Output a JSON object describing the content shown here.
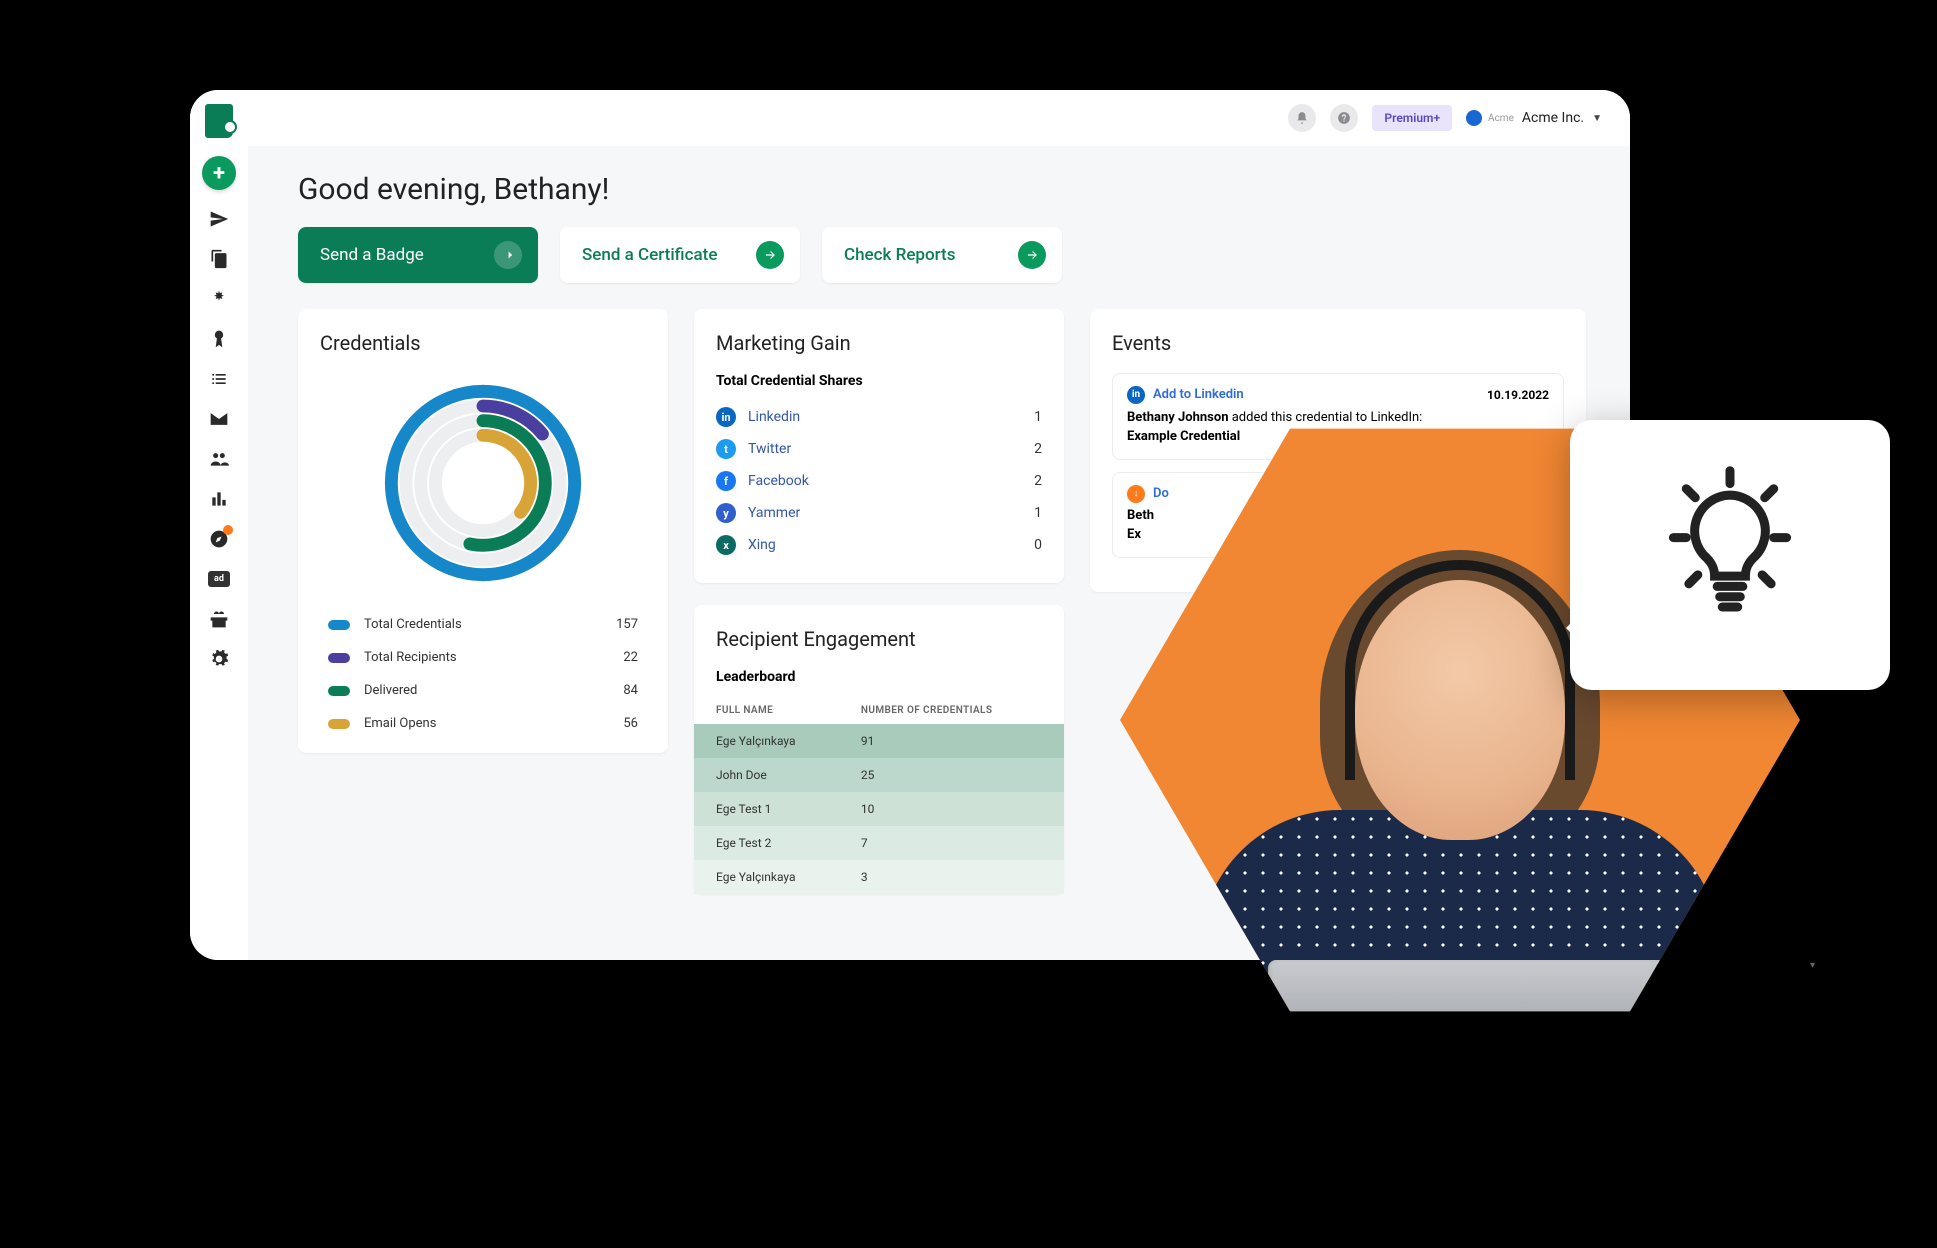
{
  "header": {
    "premium_label": "Premium+",
    "org_sub": "Acme",
    "org_name": "Acme Inc."
  },
  "greeting": "Good evening, Bethany!",
  "actions": {
    "badge": "Send a Badge",
    "certificate": "Send a Certificate",
    "reports": "Check Reports"
  },
  "credentials": {
    "title": "Credentials",
    "legend": [
      {
        "label": "Total Credentials",
        "value": "157",
        "color": "#1688c9"
      },
      {
        "label": "Total Recipients",
        "value": "22",
        "color": "#4a3e9e"
      },
      {
        "label": "Delivered",
        "value": "84",
        "color": "#0b7d56"
      },
      {
        "label": "Email Opens",
        "value": "56",
        "color": "#d9a437"
      }
    ]
  },
  "marketing": {
    "title": "Marketing Gain",
    "subtitle": "Total Credential Shares",
    "shares": [
      {
        "label": "Linkedin",
        "value": "1",
        "bg": "#0a66c2",
        "letter": "in"
      },
      {
        "label": "Twitter",
        "value": "2",
        "bg": "#1d9bf0",
        "letter": "t"
      },
      {
        "label": "Facebook",
        "value": "2",
        "bg": "#1877f2",
        "letter": "f"
      },
      {
        "label": "Yammer",
        "value": "1",
        "bg": "#2f5fcf",
        "letter": "y"
      },
      {
        "label": "Xing",
        "value": "0",
        "bg": "#0b6b62",
        "letter": "x"
      }
    ]
  },
  "engagement": {
    "title": "Recipient Engagement",
    "subtitle": "Leaderboard",
    "col1": "Full Name",
    "col2": "Number of Credentials",
    "rows": [
      {
        "name": "Ege Yalçınkaya",
        "count": "91"
      },
      {
        "name": "John Doe",
        "count": "25"
      },
      {
        "name": "Ege Test 1",
        "count": "10"
      },
      {
        "name": "Ege Test 2",
        "count": "7"
      },
      {
        "name": "Ege Yalçınkaya",
        "count": "3"
      }
    ]
  },
  "events": {
    "title": "Events",
    "items": [
      {
        "icon_bg": "#0a66c2",
        "icon_letter": "in",
        "action": "Add to Linkedin",
        "date": "10.19.2022",
        "line_bold1": "Bethany Johnson",
        "line_rest": " added this credential to LinkedIn:",
        "line2": "Example Credential"
      },
      {
        "icon_bg": "#ff7a1a",
        "icon_letter": "↓",
        "action": "Do",
        "date": "",
        "line_bold1": "Beth",
        "line_rest": "",
        "line2": "Ex"
      }
    ]
  },
  "sidebar_ad": "ad",
  "chart_data": {
    "type": "donut",
    "title": "Credentials",
    "series": [
      {
        "name": "Total Credentials",
        "value": 157,
        "color": "#1688c9"
      },
      {
        "name": "Total Recipients",
        "value": 22,
        "color": "#4a3e9e"
      },
      {
        "name": "Delivered",
        "value": 84,
        "color": "#0b7d56"
      },
      {
        "name": "Email Opens",
        "value": 56,
        "color": "#d9a437"
      }
    ],
    "note": "Concentric arc style — each series rendered as partial ring; denominator reference = 157"
  }
}
